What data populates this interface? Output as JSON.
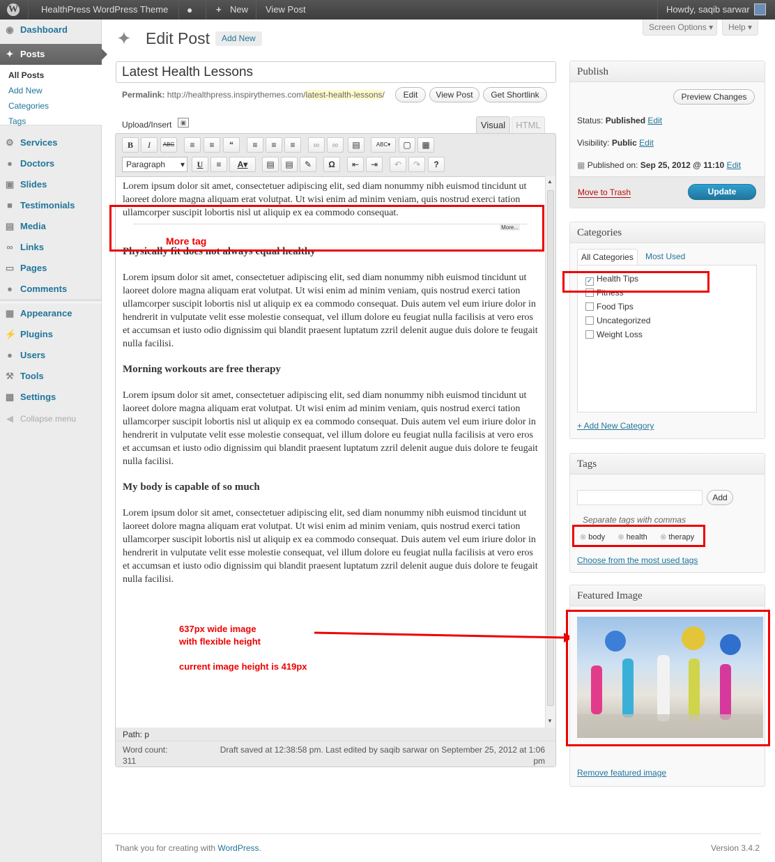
{
  "adminbar": {
    "site_name": "HealthPress WordPress Theme",
    "new_label": "New",
    "view_post": "View Post",
    "howdy": "Howdy, saqib sarwar"
  },
  "header": {
    "screen_options": "Screen Options",
    "help": "Help",
    "page_title": "Edit Post",
    "add_new": "Add New"
  },
  "sidebar": {
    "dashboard": "Dashboard",
    "posts": "Posts",
    "posts_sub": [
      "All Posts",
      "Add New",
      "Categories",
      "Tags"
    ],
    "services": "Services",
    "doctors": "Doctors",
    "slides": "Slides",
    "testimonials": "Testimonials",
    "media": "Media",
    "links": "Links",
    "pages": "Pages",
    "comments": "Comments",
    "appearance": "Appearance",
    "plugins": "Plugins",
    "users": "Users",
    "tools": "Tools",
    "settings": "Settings",
    "collapse": "Collapse menu"
  },
  "post": {
    "title": "Latest Health Lessons",
    "permalink_label": "Permalink:",
    "permalink_base": "http://healthpress.inspirythemes.com/",
    "permalink_slug": "latest-health-lessons",
    "permalink_end": "/",
    "edit": "Edit",
    "view_post": "View Post",
    "get_shortlink": "Get Shortlink"
  },
  "editor": {
    "upload_insert": "Upload/Insert",
    "tab_visual": "Visual",
    "tab_html": "HTML",
    "format": "Paragraph",
    "para": "Lorem ipsum dolor sit amet, consectetuer adipiscing elit, sed diam nonummy nibh euismod tincidunt ut laoreet dolore magna aliquam erat volutpat. Ut wisi enim ad minim veniam, quis nostrud exerci tation ullamcorper suscipit lobortis nisl ut aliquip ex ea commodo consequat.",
    "para_long": "Lorem ipsum dolor sit amet, consectetuer adipiscing elit, sed diam nonummy nibh euismod tincidunt ut laoreet dolore magna aliquam erat volutpat. Ut wisi enim ad minim veniam, quis nostrud exerci tation ullamcorper suscipit lobortis nisl ut aliquip ex ea commodo consequat. Duis autem vel eum iriure dolor in hendrerit in vulputate velit esse molestie consequat, vel illum dolore eu feugiat nulla facilisis at vero eros et accumsan et iusto odio dignissim qui blandit praesent luptatum zzril delenit augue duis dolore te feugait nulla facilisi.",
    "more": "More...",
    "h1": "Physically fit does not always equal healthy",
    "h2": "Morning workouts are free therapy",
    "h3": "My body is capable of so much",
    "path": "Path: p",
    "word_count_label": "Word count:",
    "word_count": "311",
    "draft_saved": "Draft saved at 12:38:58 pm. Last edited by saqib sarwar on September 25, 2012 at 1:06 pm"
  },
  "annotations": {
    "more_tag": "More tag",
    "img1": "637px wide image",
    "img2": "with flexible height",
    "img3": "current image height is 419px"
  },
  "publish": {
    "title": "Publish",
    "preview": "Preview Changes",
    "status_label": "Status:",
    "status": "Published",
    "visibility_label": "Visibility:",
    "visibility": "Public",
    "published_on_label": "Published on:",
    "published_on": "Sep 25, 2012 @ 11:10",
    "edit": "Edit",
    "trash": "Move to Trash",
    "update": "Update"
  },
  "categories": {
    "title": "Categories",
    "tab_all": "All Categories",
    "tab_used": "Most Used",
    "items": [
      "Health Tips",
      "Fitness",
      "Food Tips",
      "Uncategorized",
      "Weight Loss"
    ],
    "add_new": "+ Add New Category"
  },
  "tags": {
    "title": "Tags",
    "add": "Add",
    "hint": "Separate tags with commas",
    "list": [
      "body",
      "health",
      "therapy"
    ],
    "choose": "Choose from the most used tags"
  },
  "featured": {
    "title": "Featured Image",
    "remove": "Remove featured image"
  },
  "footer": {
    "thanks": "Thank you for creating with ",
    "wp": "WordPress",
    "dot": ".",
    "version": "Version 3.4.2"
  }
}
